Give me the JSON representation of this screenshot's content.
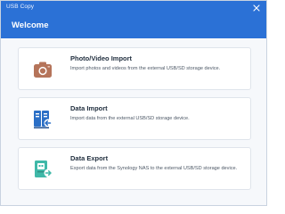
{
  "window": {
    "title": "USB Copy",
    "accent_color": "#2b71d6"
  },
  "header": {
    "title": "Welcome"
  },
  "options": [
    {
      "title": "Photo/Video Import",
      "description": "Import photos and videos from the external USB/SD storage device.",
      "icon": "camera-icon",
      "icon_color": "#b5745a"
    },
    {
      "title": "Data Import",
      "description": "Import data from the external USB/SD storage device.",
      "icon": "data-import-icon",
      "icon_color": "#2b6fc6"
    },
    {
      "title": "Data Export",
      "description": "Export data from the Synology NAS to the external USB/SD storage device.",
      "icon": "data-export-icon",
      "icon_color": "#3fb8a8"
    }
  ]
}
